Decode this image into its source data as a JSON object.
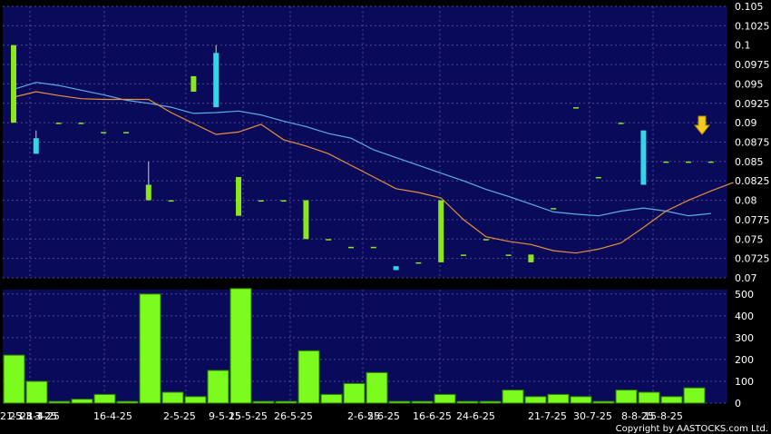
{
  "chart_data": [
    {
      "type": "candlestick",
      "panel": "price",
      "ylim": [
        0.07,
        0.105
      ],
      "yticks": [
        "0.105",
        "0.1025",
        "0.1",
        "0.0975",
        "0.095",
        "0.0925",
        "0.09",
        "0.0875",
        "0.085",
        "0.0825",
        "0.08",
        "0.0775",
        "0.075",
        "0.0725",
        "0.07"
      ],
      "grid": true,
      "colors": {
        "background": "#0a0a5a",
        "grid": "#4a4a8a",
        "up": "#8ce61e",
        "down": "#33d6e6",
        "ma_short": "#e8903a",
        "ma_long": "#5aaee8",
        "marker": "#f2cc20"
      },
      "candles": [
        {
          "o": 0.09,
          "h": 0.1,
          "l": 0.09,
          "c": 0.1
        },
        {
          "o": 0.088,
          "h": 0.089,
          "l": 0.086,
          "c": 0.086
        },
        {
          "o": 0.09,
          "h": 0.09,
          "l": 0.09,
          "c": 0.09
        },
        {
          "o": 0.09,
          "h": 0.09,
          "l": 0.09,
          "c": 0.09
        },
        {
          "o": 0.0888,
          "h": 0.0888,
          "l": 0.0888,
          "c": 0.0888
        },
        {
          "o": 0.0888,
          "h": 0.0888,
          "l": 0.0888,
          "c": 0.0888
        },
        {
          "o": 0.08,
          "h": 0.085,
          "l": 0.08,
          "c": 0.082
        },
        {
          "o": 0.08,
          "h": 0.08,
          "l": 0.08,
          "c": 0.08
        },
        {
          "o": 0.094,
          "h": 0.096,
          "l": 0.094,
          "c": 0.096
        },
        {
          "o": 0.099,
          "h": 0.1,
          "l": 0.092,
          "c": 0.092
        },
        {
          "o": 0.078,
          "h": 0.083,
          "l": 0.078,
          "c": 0.083
        },
        {
          "o": 0.08,
          "h": 0.08,
          "l": 0.08,
          "c": 0.08
        },
        {
          "o": 0.08,
          "h": 0.08,
          "l": 0.08,
          "c": 0.08
        },
        {
          "o": 0.075,
          "h": 0.08,
          "l": 0.075,
          "c": 0.08
        },
        {
          "o": 0.075,
          "h": 0.075,
          "l": 0.075,
          "c": 0.075
        },
        {
          "o": 0.074,
          "h": 0.074,
          "l": 0.074,
          "c": 0.074
        },
        {
          "o": 0.074,
          "h": 0.074,
          "l": 0.074,
          "c": 0.074
        },
        {
          "o": 0.0715,
          "h": 0.0715,
          "l": 0.071,
          "c": 0.071
        },
        {
          "o": 0.072,
          "h": 0.072,
          "l": 0.072,
          "c": 0.072
        },
        {
          "o": 0.072,
          "h": 0.08,
          "l": 0.072,
          "c": 0.08
        },
        {
          "o": 0.073,
          "h": 0.073,
          "l": 0.073,
          "c": 0.073
        },
        {
          "o": 0.075,
          "h": 0.075,
          "l": 0.075,
          "c": 0.075
        },
        {
          "o": 0.073,
          "h": 0.073,
          "l": 0.073,
          "c": 0.073
        },
        {
          "o": 0.072,
          "h": 0.073,
          "l": 0.072,
          "c": 0.073
        },
        {
          "o": 0.079,
          "h": 0.079,
          "l": 0.079,
          "c": 0.079
        },
        {
          "o": 0.092,
          "h": 0.092,
          "l": 0.092,
          "c": 0.092
        },
        {
          "o": 0.083,
          "h": 0.083,
          "l": 0.083,
          "c": 0.083
        },
        {
          "o": 0.09,
          "h": 0.09,
          "l": 0.09,
          "c": 0.09
        },
        {
          "o": 0.089,
          "h": 0.089,
          "l": 0.082,
          "c": 0.082
        },
        {
          "o": 0.085,
          "h": 0.085,
          "l": 0.085,
          "c": 0.085
        },
        {
          "o": 0.085,
          "h": 0.085,
          "l": 0.085,
          "c": 0.085
        },
        {
          "o": 0.085,
          "h": 0.085,
          "l": 0.085,
          "c": 0.085
        }
      ],
      "ma_short": [
        0.0933,
        0.094,
        0.0935,
        0.0931,
        0.093,
        0.093,
        0.093,
        0.0913,
        0.0899,
        0.0885,
        0.0888,
        0.0898,
        0.0878,
        0.087,
        0.086,
        0.0845,
        0.083,
        0.0815,
        0.081,
        0.0803,
        0.0775,
        0.0753,
        0.0747,
        0.0743,
        0.0735,
        0.0732,
        0.0737,
        0.0745,
        0.0765,
        0.0786,
        0.08,
        0.0812,
        0.0823
      ],
      "ma_long": [
        0.0943,
        0.0952,
        0.0948,
        0.0942,
        0.0936,
        0.0929,
        0.0925,
        0.092,
        0.0912,
        0.0913,
        0.0915,
        0.091,
        0.0902,
        0.0895,
        0.0886,
        0.088,
        0.0865,
        0.0855,
        0.0845,
        0.0835,
        0.0825,
        0.0814,
        0.0805,
        0.0795,
        0.0785,
        0.0782,
        0.078,
        0.0786,
        0.079,
        0.0786,
        0.078,
        0.0783
      ]
    },
    {
      "type": "bar",
      "panel": "volume",
      "ylim": [
        0,
        520
      ],
      "yticks": [
        "500",
        "400",
        "300",
        "200",
        "100",
        "0"
      ],
      "grid": true,
      "colors": {
        "bar": "#7cfc1e",
        "bar_edge": "#2a7a00"
      },
      "values": [
        220,
        100,
        8,
        18,
        40,
        8,
        500,
        50,
        30,
        150,
        525,
        8,
        8,
        240,
        40,
        90,
        140,
        8,
        8,
        40,
        8,
        8,
        60,
        30,
        40,
        30,
        8,
        60,
        50,
        30,
        70
      ]
    }
  ],
  "x_axis": {
    "tick_labels": [
      "21-3",
      "25-3",
      "28-3",
      "1-4-25",
      "3-25",
      "16-4-25",
      "2-5-25",
      "9-5-25",
      "15-5-25",
      "26-5-25",
      "2-6-25",
      "5-6-25",
      "16-6-25",
      "24-6-25",
      "21-7-25",
      "30-7-25",
      "8-8-25",
      "15-8-25"
    ]
  },
  "copyright": "Copyright by AASTOCKS.com Ltd."
}
